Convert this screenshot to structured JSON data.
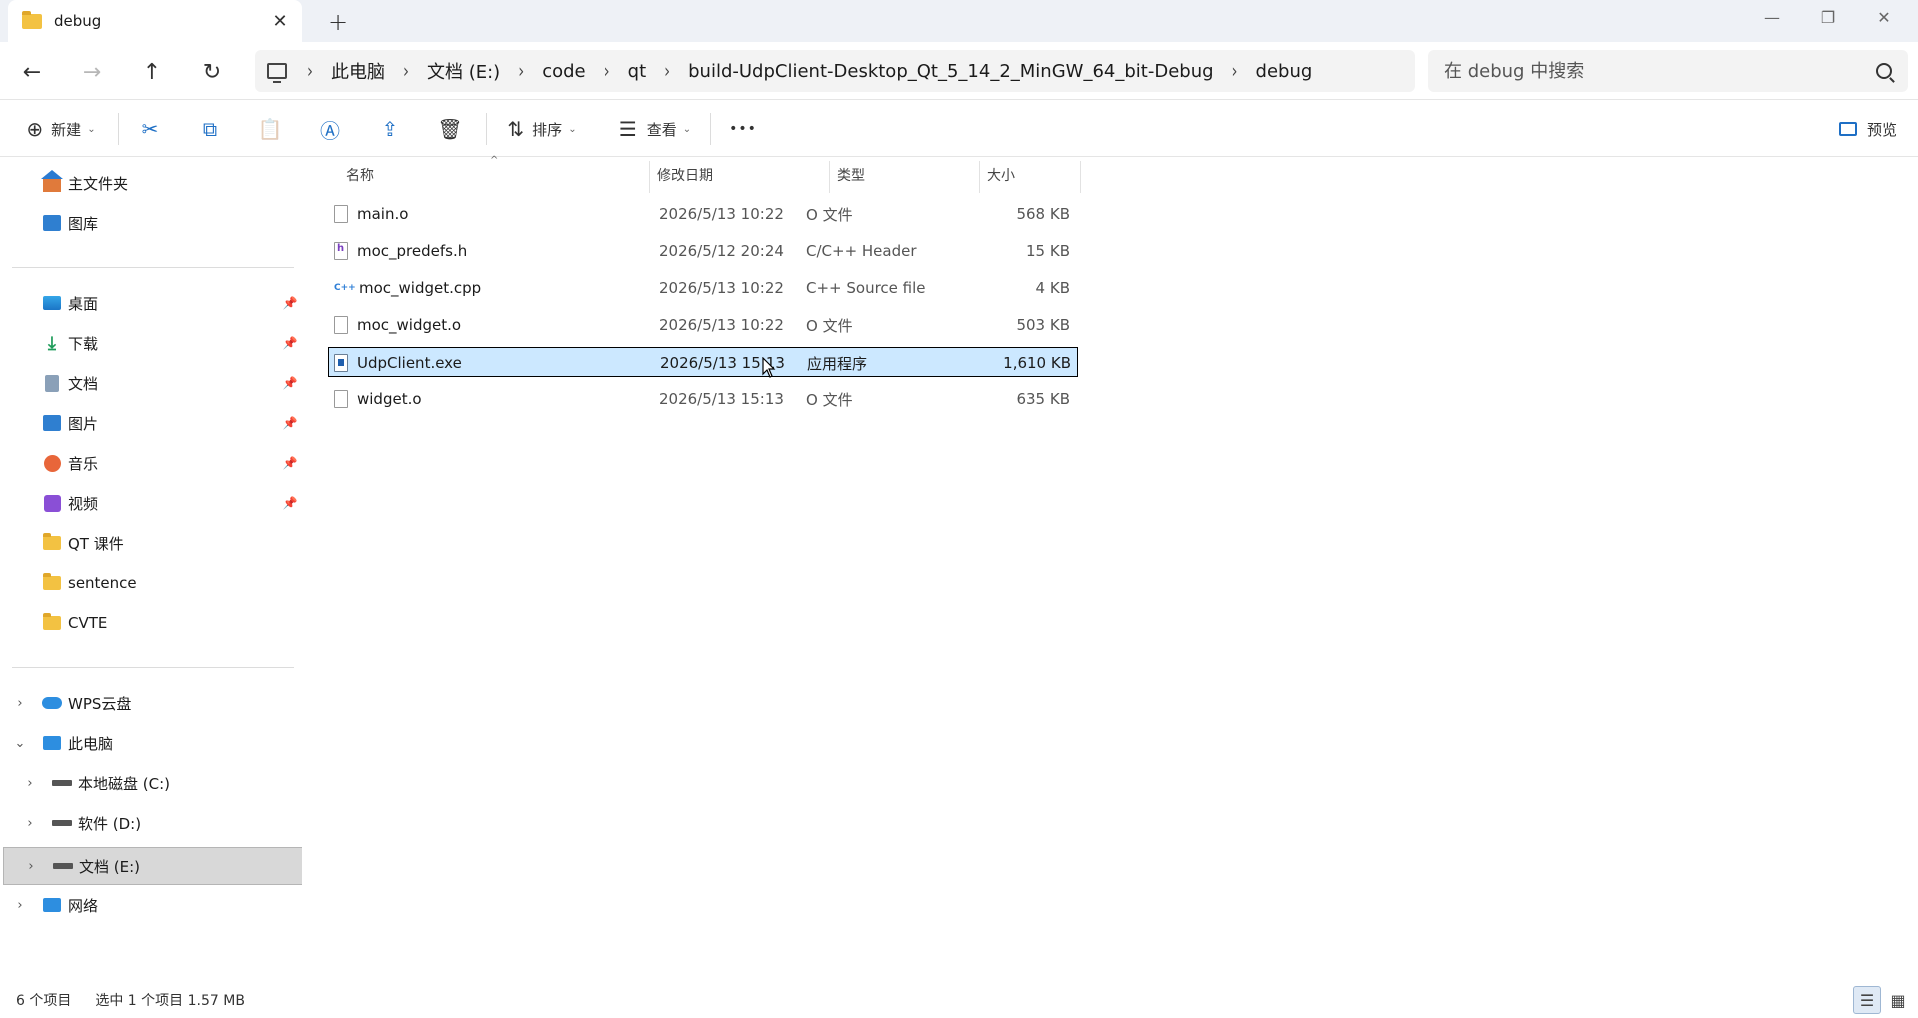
{
  "tab": {
    "title": "debug",
    "close": "✕",
    "new": "+"
  },
  "window": {
    "minimize": "—",
    "restore": "❐",
    "close": "✕"
  },
  "nav": {
    "back": "←",
    "forward": "→",
    "up": "↑",
    "refresh": "↻"
  },
  "breadcrumb": {
    "items": [
      "此电脑",
      "文档 (E:)",
      "code",
      "qt",
      "build-UdpClient-Desktop_Qt_5_14_2_MinGW_64_bit-Debug",
      "debug"
    ],
    "sep": "›"
  },
  "search": {
    "placeholder": "在 debug 中搜索"
  },
  "toolbar": {
    "new_label": "新建",
    "sort_label": "排序",
    "view_label": "查看",
    "more": "•••",
    "preview_label": "预览",
    "icons": {
      "new": "⊕",
      "cut": "✂",
      "copy": "⧉",
      "paste": "📋",
      "rename": "Ⓐ",
      "share": "⇪",
      "delete": "🗑",
      "sort": "⇅",
      "view": "☰"
    }
  },
  "sidebar": {
    "quick": [
      {
        "label": "主文件夹",
        "icon": "home-icon"
      },
      {
        "label": "图库",
        "icon": "gallery-icon"
      }
    ],
    "pinned": [
      {
        "label": "桌面",
        "icon": "desktop-icon",
        "pin": "📌"
      },
      {
        "label": "下载",
        "icon": "download-icon",
        "pin": "📌"
      },
      {
        "label": "文档",
        "icon": "document-icon",
        "pin": "📌"
      },
      {
        "label": "图片",
        "icon": "pictures-icon",
        "pin": "📌"
      },
      {
        "label": "音乐",
        "icon": "music-icon",
        "pin": "📌"
      },
      {
        "label": "视频",
        "icon": "video-icon",
        "pin": "📌"
      },
      {
        "label": "QT 课件",
        "icon": "folder-icon"
      },
      {
        "label": "sentence",
        "icon": "folder-icon"
      },
      {
        "label": "CVTE",
        "icon": "folder-icon"
      }
    ],
    "tree": [
      {
        "label": "WPS云盘",
        "icon": "cloud-icon",
        "chev": "›"
      },
      {
        "label": "此电脑",
        "icon": "pc-icon",
        "chev": "⌄"
      },
      {
        "label": "本地磁盘 (C:)",
        "icon": "drive-icon",
        "chev": "›"
      },
      {
        "label": "软件 (D:)",
        "icon": "drive-icon",
        "chev": "›"
      },
      {
        "label": "文档 (E:)",
        "icon": "drive-icon",
        "chev": "›"
      },
      {
        "label": "网络",
        "icon": "network-icon",
        "chev": "›"
      }
    ],
    "download_glyph": "⤓"
  },
  "columns": {
    "name": "名称",
    "date": "修改日期",
    "type": "类型",
    "size": "大小",
    "sort_glyph": "^"
  },
  "files": [
    {
      "name": "main.o",
      "date": "2026/5/13 10:22",
      "type": "O 文件",
      "size": "568 KB",
      "icon": "file-icon"
    },
    {
      "name": "moc_predefs.h",
      "date": "2026/5/12 20:24",
      "type": "C/C++ Header",
      "size": "15 KB",
      "icon": "header-file-icon"
    },
    {
      "name": "moc_widget.cpp",
      "date": "2026/5/13 10:22",
      "type": "C++ Source file",
      "size": "4 KB",
      "icon": "cpp-file-icon",
      "icon_text": "C++"
    },
    {
      "name": "moc_widget.o",
      "date": "2026/5/13 10:22",
      "type": "O 文件",
      "size": "503 KB",
      "icon": "file-icon"
    },
    {
      "name": "UdpClient.exe",
      "date": "2026/5/13 15:13",
      "type": "应用程序",
      "size": "1,610 KB",
      "icon": "exe-file-icon",
      "selected": true
    },
    {
      "name": "widget.o",
      "date": "2026/5/13 15:13",
      "type": "O 文件",
      "size": "635 KB",
      "icon": "file-icon"
    }
  ],
  "status": {
    "count": "6 个项目",
    "selection": "选中 1 个项目 1.57 MB"
  },
  "view_buttons": {
    "details": "☰",
    "tiles": "▦"
  }
}
